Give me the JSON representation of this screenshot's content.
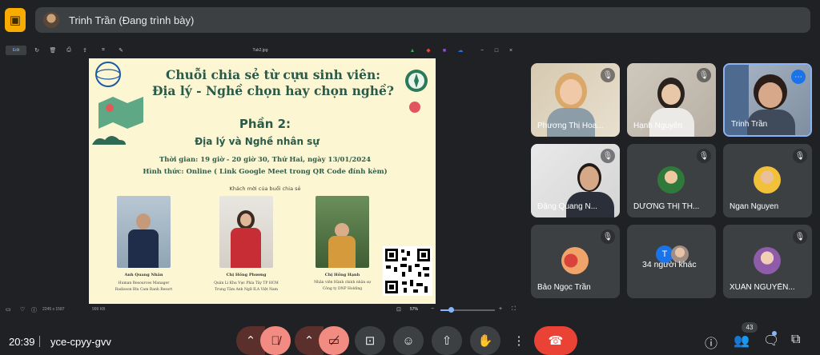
{
  "header": {
    "presenter_label": "Trinh Trần (Đang trình bày)"
  },
  "viewer": {
    "edit_label": "Edit",
    "file_name": "Tuk2.jpg",
    "zoom": "57%",
    "image_info": "2245 x 1587",
    "file_size": "999 KB"
  },
  "slide": {
    "title_line1": "Chuỗi chia sẻ từ cựu sinh viên:",
    "title_line2": "Địa lý - Nghề chọn hay chọn nghề?",
    "part": "Phần 2:",
    "subtitle": "Địa lý và Nghề nhân sự",
    "time": "Thời gian: 19 giờ - 20 giờ 30, Thứ Hai, ngày 13/01/2024",
    "format": "Hình thức: Online ( Link Google Meet trong QR Code đính kèm)",
    "guests_heading": "Khách mời của buổi chia sẻ",
    "guests": [
      {
        "name": "Anh Quang Nhân",
        "role1": "Human Resources Manager",
        "role2": "Radisson Blu Cam Ranh Resort"
      },
      {
        "name": "Chị Hồng Phương",
        "role1": "Quản Lí Khu Vực Phía Tây TP HCM",
        "role2": "Trung Tâm Anh Ngữ ILA Việt Nam"
      },
      {
        "name": "Chị Hồng Hạnh",
        "role1": "Nhân viên Hành chính nhân sự",
        "role2": "Công ty DNP Holding"
      }
    ]
  },
  "participants": [
    {
      "name": "Phương Thị Hoa...",
      "muted": true,
      "type": "video"
    },
    {
      "name": "Hạnh Nguyễn",
      "muted": true,
      "type": "video"
    },
    {
      "name": "Trinh Trần",
      "muted": false,
      "type": "video",
      "active": true
    },
    {
      "name": "Đặng Quang N...",
      "muted": true,
      "type": "video"
    },
    {
      "name": "DƯƠNG THỊ TH...",
      "muted": true,
      "type": "avatar"
    },
    {
      "name": "Ngan Nguyen",
      "muted": true,
      "type": "avatar"
    },
    {
      "name": "Bảo Ngọc Trần",
      "muted": true,
      "type": "avatar"
    },
    {
      "name": "34 người khác",
      "muted": false,
      "type": "group",
      "initial": "T"
    },
    {
      "name": "XUÂN NGUYỄN...",
      "muted": true,
      "type": "avatar"
    }
  ],
  "footer": {
    "time": "20:39",
    "meeting_code": "yce-cpyy-gvv",
    "people_count": "43"
  },
  "colors": {
    "background": "#202124",
    "tile": "#3c4043",
    "slide_bg": "#fdf6d3",
    "slide_text": "#2a5a48",
    "mute_red": "#f28b82",
    "leave_red": "#ea4335",
    "active_border": "#8ab4f8"
  }
}
